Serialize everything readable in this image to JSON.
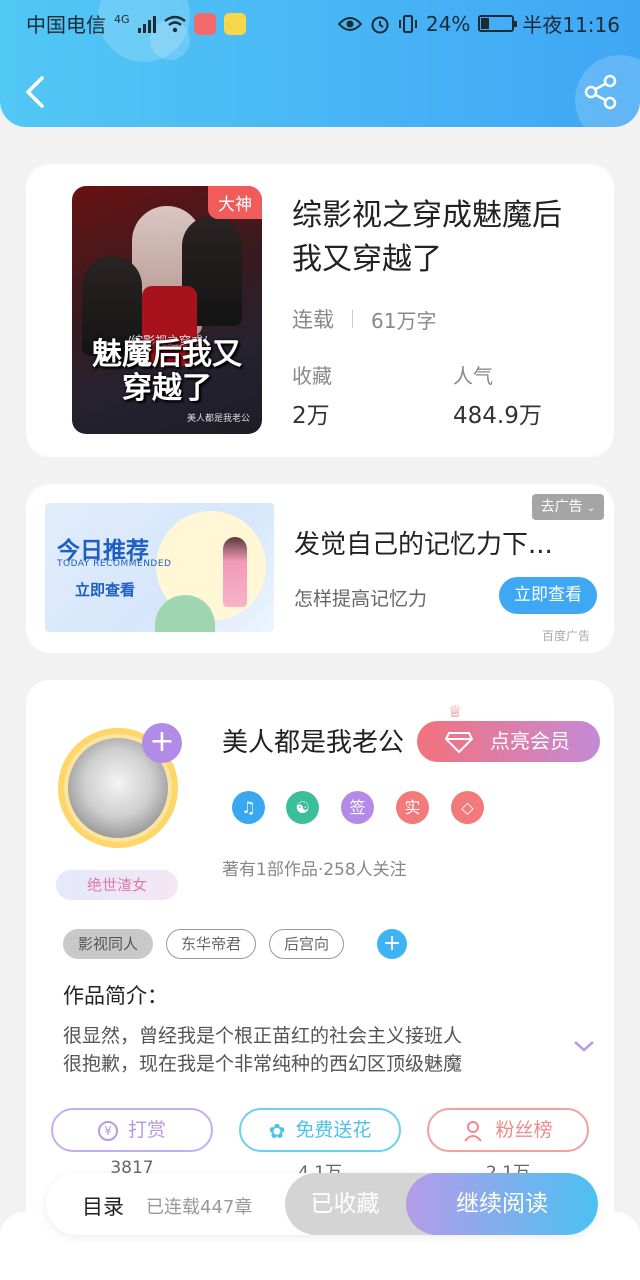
{
  "status_bar": {
    "carrier": "中国电信",
    "network": "4G",
    "battery": "24%",
    "time": "半夜11:16",
    "battery_level": 0.24
  },
  "book": {
    "badge": "大神",
    "cover_subtitle": "/综影视之穿成/",
    "cover_title": "魅魔后我又穿越了",
    "cover_author": "美人都是我老公",
    "title": "综影视之穿成魅魔后我又穿越了",
    "status": "连载",
    "word_count": "61万字",
    "favorites_label": "收藏",
    "favorites_value": "2万",
    "popularity_label": "人气",
    "popularity_value": "484.9万"
  },
  "ad": {
    "image_line1": "今日推荐",
    "image_line2": "TODAY RECOMMENDED",
    "image_line3": "立即查看",
    "title": "发觉自己的记忆力下...",
    "subtitle": "怎样提高记忆力",
    "button": "立即查看",
    "remove": "去广告",
    "source": "百度广告"
  },
  "author": {
    "name": "美人都是我老公",
    "tag": "绝世渣女",
    "vip_button": "点亮会员",
    "badges": [
      "签",
      "实"
    ],
    "stats": "著有1部作品·258人关注"
  },
  "tags": [
    "影视同人",
    "东华帝君",
    "后宫向"
  ],
  "intro": {
    "title": "作品简介：",
    "line1": "很显然，曾经我是个根正苗红的社会主义接班人",
    "line2": "很抱歉，现在我是个非常纯种的西幻区顶级魅魔"
  },
  "actions": [
    {
      "label": "打赏",
      "count": "3817",
      "color": "#b79ae0"
    },
    {
      "label": "免费送花",
      "count": "4.1万",
      "color": "#4cc3e8"
    },
    {
      "label": "粉丝榜",
      "count": "2.1万",
      "color": "#f08a8a"
    }
  ],
  "bottom": {
    "toc": "目录",
    "chapters": "已连载447章",
    "collected": "已收藏",
    "continue": "继续阅读"
  }
}
